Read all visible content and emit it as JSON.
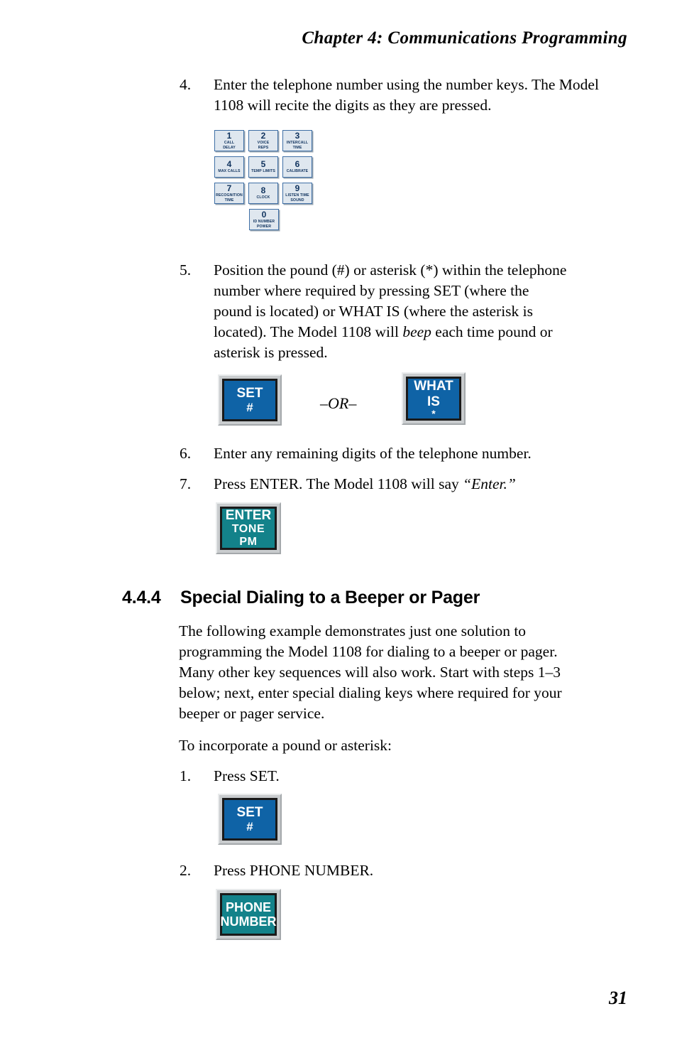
{
  "page": {
    "running_head": "Chapter  4:  Communications Programming",
    "folio": "31"
  },
  "colors": {
    "button_blue": "#0f63a6",
    "button_teal": "#13828a",
    "button_bezel": "#c9ccce",
    "keypad_face": "#dfe7ef",
    "keypad_border": "#3f6fa5",
    "keypad_text": "#10335e"
  },
  "steps": {
    "s4": {
      "num": "4.",
      "text": "Enter the telephone number using the number keys. The Model 1108 will recite the digits as they are pressed."
    },
    "s5": {
      "num": "5.",
      "line1": "Position the pound (#) or asterisk (*) within the telephone",
      "line2": "number where required by pressing SET (where the",
      "line3": "pound is located) or  WHAT IS  (where the asterisk is",
      "line4a": "located).  The Model 1108 will ",
      "line4b": "beep",
      "line4c": " each time pound or",
      "line5": "asterisk is pressed."
    },
    "s6": {
      "num": "6.",
      "text": "Enter any remaining digits of the telephone number."
    },
    "s7": {
      "num": "7.",
      "text_a": "Press ENTER. The Model 1108 will say ",
      "text_b": "“Enter.”"
    },
    "p1": {
      "num": "1.",
      "text": "Press SET."
    },
    "p2": {
      "num": "2.",
      "text": "Press PHONE NUMBER."
    }
  },
  "keypad": {
    "rows": [
      [
        {
          "digit": "1",
          "sub": "CALL\nDELAY"
        },
        {
          "digit": "2",
          "sub": "VOICE\nREPS"
        },
        {
          "digit": "3",
          "sub": "INTERCALL\nTIME"
        }
      ],
      [
        {
          "digit": "4",
          "sub": "MAX CALLS"
        },
        {
          "digit": "5",
          "sub": "TEMP LIMITS"
        },
        {
          "digit": "6",
          "sub": "CALIBRATE"
        }
      ],
      [
        {
          "digit": "7",
          "sub": "RECOGNITION\nTIME"
        },
        {
          "digit": "8",
          "sub": "CLOCK"
        },
        {
          "digit": "9",
          "sub": "LISTEN TIME\nSOUND"
        }
      ],
      [
        {
          "digit": "0",
          "sub": "ID NUMBER\nPOWER"
        }
      ]
    ]
  },
  "buttons": {
    "set_1": {
      "line1": "SET",
      "line2": "#",
      "color": "blue"
    },
    "what_is": {
      "line1": "WHAT",
      "line2": "IS",
      "line3": "*",
      "color": "blue"
    },
    "or_label": "–OR–",
    "enter": {
      "line1": "ENTER",
      "line2": "TONE",
      "line3": "PM",
      "color": "teal"
    },
    "set_2": {
      "line1": "SET",
      "line2": "#",
      "color": "blue"
    },
    "phone_number": {
      "line1": "PHONE",
      "line2": "NUMBER",
      "color": "teal"
    }
  },
  "section": {
    "number": "4.4.4",
    "title": "Special Dialing to a Beeper or Pager",
    "body": {
      "l1": "The following example demonstrates just one solution to",
      "l2": "programming the Model 1108 for dialing to a beeper or pager.",
      "l3": "Many other key sequences will also work. Start with steps 1–3",
      "l4": "below; next, enter special dialing keys where required for your",
      "l5": "beeper or pager service."
    },
    "intro": "To incorporate a pound or asterisk:"
  }
}
